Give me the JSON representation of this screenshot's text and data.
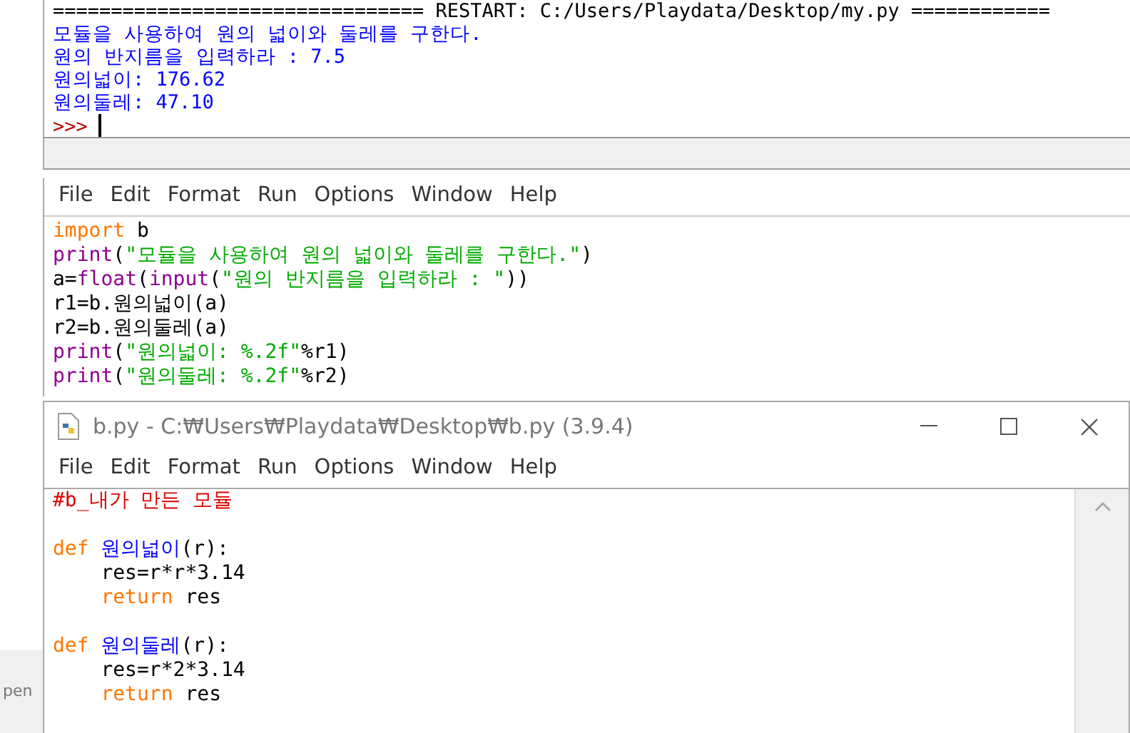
{
  "shell": {
    "lines": [
      {
        "kind": "restart",
        "text": "================================ RESTART: C:/Users/Playdata/Desktop/my.py ============"
      },
      {
        "kind": "output",
        "text": "모듈을 사용하여 원의 넓이와 둘레를 구한다."
      },
      {
        "kind": "output",
        "text": "원의 반지름을 입력하라 : 7.5"
      },
      {
        "kind": "output",
        "text": "원의넓이: 176.62"
      },
      {
        "kind": "output",
        "text": "원의둘레: 47.10"
      },
      {
        "kind": "prompt",
        "text": ">>>"
      }
    ]
  },
  "main_editor": {
    "menu": [
      "File",
      "Edit",
      "Format",
      "Run",
      "Options",
      "Window",
      "Help"
    ],
    "lines": [
      {
        "kind": "code",
        "tokens": [
          {
            "kind": "keyword",
            "text": "import"
          },
          {
            "kind": "plain",
            "text": " b"
          }
        ]
      },
      {
        "kind": "code",
        "tokens": [
          {
            "kind": "builtin",
            "text": "print"
          },
          {
            "kind": "plain",
            "text": "("
          },
          {
            "kind": "string",
            "text": "\"모듈을 사용하여 원의 넓이와 둘레를 구한다.\""
          },
          {
            "kind": "plain",
            "text": ")"
          }
        ]
      },
      {
        "kind": "code",
        "tokens": [
          {
            "kind": "plain",
            "text": "a="
          },
          {
            "kind": "builtin",
            "text": "float"
          },
          {
            "kind": "plain",
            "text": "("
          },
          {
            "kind": "builtin",
            "text": "input"
          },
          {
            "kind": "plain",
            "text": "("
          },
          {
            "kind": "string",
            "text": "\"원의 반지름을 입력하라 : \""
          },
          {
            "kind": "plain",
            "text": "))"
          }
        ]
      },
      {
        "kind": "code",
        "tokens": [
          {
            "kind": "plain",
            "text": "r1=b.원의넓이(a)"
          }
        ]
      },
      {
        "kind": "code",
        "tokens": [
          {
            "kind": "plain",
            "text": "r2=b.원의둘레(a)"
          }
        ]
      },
      {
        "kind": "code",
        "tokens": [
          {
            "kind": "builtin",
            "text": "print"
          },
          {
            "kind": "plain",
            "text": "("
          },
          {
            "kind": "string",
            "text": "\"원의넓이: %.2f\""
          },
          {
            "kind": "plain",
            "text": "%r1)"
          }
        ]
      },
      {
        "kind": "code",
        "tokens": [
          {
            "kind": "builtin",
            "text": "print"
          },
          {
            "kind": "plain",
            "text": "("
          },
          {
            "kind": "string",
            "text": "\"원의둘레: %.2f\""
          },
          {
            "kind": "plain",
            "text": "%r2)"
          }
        ]
      }
    ]
  },
  "module_editor": {
    "title": "b.py - C:₩Users₩Playdata₩Desktop₩b.py (3.9.4)",
    "menu": [
      "File",
      "Edit",
      "Format",
      "Run",
      "Options",
      "Window",
      "Help"
    ],
    "lines": [
      {
        "kind": "code",
        "tokens": [
          {
            "kind": "comment",
            "text": "#b_내가 만든 모듈"
          }
        ]
      },
      {
        "kind": "blank"
      },
      {
        "kind": "code",
        "tokens": [
          {
            "kind": "keyword",
            "text": "def "
          },
          {
            "kind": "definition",
            "text": "원의넓이"
          },
          {
            "kind": "plain",
            "text": "(r):"
          }
        ],
        "children": [
          {
            "kind": "code",
            "tokens": [
              {
                "kind": "plain",
                "text": "res=r*r*3.14"
              }
            ]
          },
          {
            "kind": "code",
            "tokens": [
              {
                "kind": "keyword",
                "text": "return "
              },
              {
                "kind": "plain",
                "text": "res"
              }
            ]
          }
        ]
      },
      {
        "kind": "blank"
      },
      {
        "kind": "code",
        "tokens": [
          {
            "kind": "keyword",
            "text": "def "
          },
          {
            "kind": "definition",
            "text": "원의둘레"
          },
          {
            "kind": "plain",
            "text": "(r):"
          }
        ],
        "children": [
          {
            "kind": "code",
            "tokens": [
              {
                "kind": "plain",
                "text": "res=r*2*3.14"
              }
            ]
          },
          {
            "kind": "code",
            "tokens": [
              {
                "kind": "keyword",
                "text": "return "
              },
              {
                "kind": "plain",
                "text": "res"
              }
            ]
          }
        ]
      }
    ]
  },
  "desktop": {
    "fragment": "pen"
  }
}
